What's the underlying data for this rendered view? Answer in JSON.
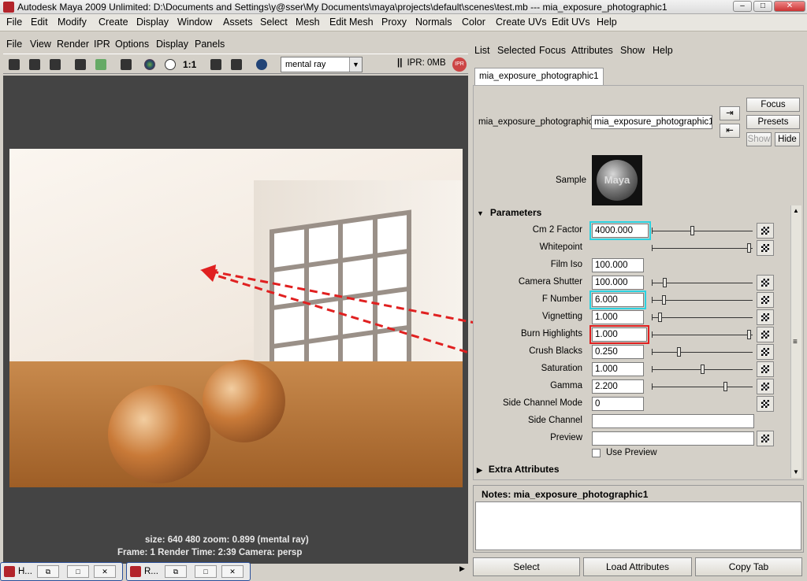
{
  "window": {
    "title": "Autodesk Maya 2009 Unlimited: D:\\Documents and Settings\\y@sser\\My Documents\\maya\\projects\\default\\scenes\\test.mb   ---   mia_exposure_photographic1"
  },
  "main_menu": [
    "File",
    "Edit",
    "Modify",
    "Create",
    "Display",
    "Window",
    "Assets",
    "Select",
    "Mesh",
    "Edit Mesh",
    "Proxy",
    "Normals",
    "Color",
    "Create UVs",
    "Edit UVs",
    "Help"
  ],
  "render_view": {
    "menu": [
      "File",
      "View",
      "Render",
      "IPR",
      "Options",
      "Display",
      "Panels"
    ],
    "ratio_label": "1:1",
    "renderer": "mental ray",
    "ipr_status": "IPR: 0MB",
    "ipr_badge": "IPR",
    "status_line1": "size:  640  480 zoom: 0.899      (mental ray)",
    "status_line2": "Frame: 1      Render Time: 2:39      Camera: persp"
  },
  "taskbar": [
    {
      "label": "H..."
    },
    {
      "label": "R..."
    }
  ],
  "attribute_editor": {
    "menu": [
      "List",
      "Selected",
      "Focus",
      "Attributes",
      "Show",
      "Help"
    ],
    "tab": "mia_exposure_photographic1",
    "node_label": "mia_exposure_photographic:",
    "node_value": "mia_exposure_photographic1",
    "buttons": {
      "focus": "Focus",
      "presets": "Presets",
      "show": "Show",
      "hide": "Hide"
    },
    "sample_label": "Sample",
    "sample_logo": "Maya",
    "section_parameters": "Parameters",
    "section_extra": "Extra Attributes",
    "params": [
      {
        "label": "Cm 2 Factor",
        "value": "4000.000",
        "slider": 0.4
      },
      {
        "label": "Whitepoint",
        "value": "",
        "slider": 1.0
      },
      {
        "label": "Film Iso",
        "value": "100.000"
      },
      {
        "label": "Camera Shutter",
        "value": "100.000",
        "slider": 0.13
      },
      {
        "label": "F Number",
        "value": "6.000",
        "slider": 0.12
      },
      {
        "label": "Vignetting",
        "value": "1.000",
        "slider": 0.08
      },
      {
        "label": "Burn Highlights",
        "value": "1.000",
        "slider": 1.0
      },
      {
        "label": "Crush Blacks",
        "value": "0.250",
        "slider": 0.25
      },
      {
        "label": "Saturation",
        "value": "1.000",
        "slider": 0.5
      },
      {
        "label": "Gamma",
        "value": "2.200",
        "slider": 0.73
      },
      {
        "label": "Side Channel Mode",
        "value": "0"
      },
      {
        "label": "Side Channel",
        "value": ""
      },
      {
        "label": "Preview",
        "value": ""
      }
    ],
    "use_preview_label": "Use Preview",
    "notes_label": "Notes:  mia_exposure_photographic1",
    "bottom_buttons": [
      "Select",
      "Load Attributes",
      "Copy Tab"
    ]
  }
}
